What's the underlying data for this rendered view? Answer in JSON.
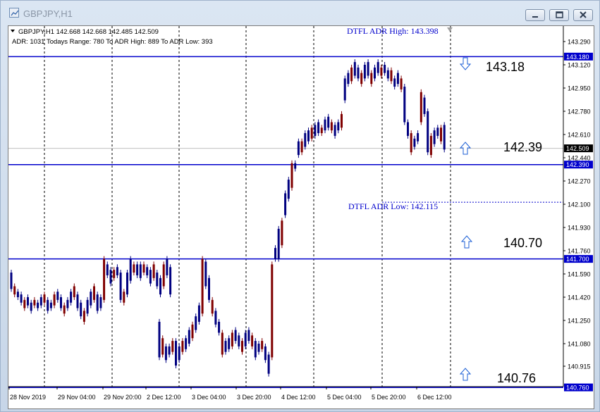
{
  "window": {
    "title": "GBPJPY,H1"
  },
  "header": {
    "symbol_line": "GBPJPY,H1  142.668 142.668 142.485 142.509",
    "adr_line": "ADR: 1031  Todays Range: 780  To ADR High: 889  To ADR Low: 393"
  },
  "annotations": {
    "adr_high": "DTFL ADR High: 143.398",
    "adr_low": "DTFL ADR Low: 142.115"
  },
  "levels": [
    {
      "price": 143.18,
      "label": "143.18",
      "price_tag": "143.180",
      "arrow": "down"
    },
    {
      "price": 142.39,
      "label": "142.39",
      "price_tag": "142.390",
      "arrow": "up"
    },
    {
      "price": 141.7,
      "label": "140.70",
      "price_tag": "141.700",
      "arrow": "up"
    },
    {
      "price": 140.76,
      "label": "140.76",
      "price_tag": "140.760",
      "arrow": "up"
    }
  ],
  "current_price": {
    "value": 142.509,
    "label": "142.509"
  },
  "colors": {
    "level_line": "#0000cc",
    "bull_candle": "#000080",
    "bear_candle": "#800000",
    "annotation_text": "#0000cc",
    "price_tag_bg": "#0000cc",
    "current_tag_bg": "#000000"
  },
  "chart_data": {
    "type": "candlestick",
    "y_ticks": [
      "143.290",
      "143.120",
      "142.950",
      "142.780",
      "142.610",
      "142.440",
      "142.270",
      "142.100",
      "141.930",
      "141.760",
      "141.590",
      "141.420",
      "141.250",
      "141.080",
      "140.915"
    ],
    "x_ticks": [
      "28 Nov 2019",
      "29 Nov 04:00",
      "29 Nov 20:00",
      "2 Dec 12:00",
      "3 Dec 04:00",
      "3 Dec 20:00",
      "4 Dec 12:00",
      "5 Dec 04:00",
      "5 Dec 20:00",
      "6 Dec 12:00"
    ],
    "ylim": [
      140.75,
      143.4
    ],
    "series": [
      {
        "segment": 1,
        "points": [
          [
            141.48,
            141.6
          ],
          [
            141.44,
            141.5
          ],
          [
            141.42,
            141.46
          ],
          [
            141.38,
            141.44
          ],
          [
            141.34,
            141.4
          ],
          [
            141.36,
            141.42
          ],
          [
            141.32,
            141.38
          ],
          [
            141.36,
            141.4
          ],
          [
            141.34,
            141.38
          ],
          [
            141.36,
            141.42
          ],
          [
            141.38,
            141.44
          ],
          [
            141.32,
            141.4
          ],
          [
            141.34,
            141.38
          ],
          [
            141.36,
            141.44
          ],
          [
            141.4,
            141.46
          ],
          [
            141.34,
            141.42
          ],
          [
            141.3,
            141.36
          ],
          [
            141.34,
            141.4
          ],
          [
            141.38,
            141.46
          ],
          [
            141.42,
            141.5
          ],
          [
            141.34,
            141.44
          ],
          [
            141.28,
            141.38
          ],
          [
            141.24,
            141.32
          ],
          [
            141.3,
            141.4
          ],
          [
            141.36,
            141.46
          ],
          [
            141.4,
            141.5
          ],
          [
            141.32,
            141.44
          ],
          [
            141.34,
            141.42
          ],
          [
            141.4,
            141.7
          ],
          [
            141.58,
            141.66
          ],
          [
            141.52,
            141.62
          ],
          [
            141.56,
            141.62
          ],
          [
            141.58,
            141.64
          ],
          [
            141.4,
            141.6
          ],
          [
            141.38,
            141.46
          ],
          [
            141.44,
            141.6
          ],
          [
            141.54,
            141.7
          ],
          [
            141.6,
            141.66
          ],
          [
            141.58,
            141.66
          ],
          [
            141.56,
            141.66
          ],
          [
            141.6,
            141.66
          ],
          [
            141.58,
            141.64
          ],
          [
            141.52,
            141.62
          ],
          [
            141.56,
            141.66
          ],
          [
            141.5,
            141.6
          ],
          [
            141.44,
            141.56
          ],
          [
            141.5,
            141.66
          ],
          [
            141.58,
            141.7
          ],
          [
            141.44,
            141.64
          ]
        ]
      },
      {
        "segment": 2,
        "points": [
          [
            140.98,
            141.24
          ],
          [
            141.0,
            141.12
          ],
          [
            140.96,
            141.06
          ],
          [
            141.0,
            141.06
          ],
          [
            141.02,
            141.1
          ],
          [
            140.92,
            141.1
          ],
          [
            140.96,
            141.06
          ],
          [
            141.02,
            141.1
          ],
          [
            141.04,
            141.12
          ],
          [
            141.08,
            141.18
          ],
          [
            141.12,
            141.22
          ],
          [
            141.18,
            141.28
          ],
          [
            141.24,
            141.36
          ],
          [
            141.3,
            141.7
          ],
          [
            141.5,
            141.68
          ],
          [
            141.4,
            141.56
          ],
          [
            141.3,
            141.4
          ],
          [
            141.22,
            141.32
          ],
          [
            141.16,
            141.24
          ],
          [
            141.0,
            141.16
          ],
          [
            141.02,
            141.1
          ],
          [
            141.04,
            141.12
          ],
          [
            141.06,
            141.16
          ],
          [
            141.1,
            141.18
          ],
          [
            141.06,
            141.14
          ],
          [
            141.02,
            141.1
          ],
          [
            141.06,
            141.16
          ],
          [
            141.1,
            141.18
          ],
          [
            141.06,
            141.14
          ],
          [
            140.98,
            141.1
          ],
          [
            141.02,
            141.08
          ],
          [
            141.04,
            141.1
          ],
          [
            140.96,
            141.06
          ],
          [
            140.86,
            141.0
          ],
          [
            140.98,
            141.66
          ],
          [
            141.7,
            141.78
          ],
          [
            141.7,
            141.92
          ],
          [
            141.8,
            141.98
          ],
          [
            142.02,
            142.18
          ],
          [
            142.14,
            142.28
          ],
          [
            142.22,
            142.4
          ],
          [
            142.36,
            142.4
          ],
          [
            142.46,
            142.56
          ],
          [
            142.48,
            142.56
          ],
          [
            142.52,
            142.62
          ],
          [
            142.56,
            142.64
          ],
          [
            142.58,
            142.66
          ],
          [
            142.6,
            142.68
          ],
          [
            142.62,
            142.7
          ],
          [
            142.62,
            142.66
          ],
          [
            142.64,
            142.72
          ],
          [
            142.66,
            142.74
          ],
          [
            142.64,
            142.7
          ],
          [
            142.6,
            142.68
          ],
          [
            142.64,
            142.7
          ],
          [
            142.66,
            142.76
          ],
          [
            142.86,
            143.02
          ],
          [
            142.98,
            143.06
          ],
          [
            143.0,
            143.1
          ],
          [
            143.04,
            143.14
          ],
          [
            143.02,
            143.1
          ],
          [
            142.98,
            143.06
          ],
          [
            143.02,
            143.12
          ],
          [
            143.04,
            143.14
          ],
          [
            142.98,
            143.06
          ],
          [
            143.02,
            143.1
          ],
          [
            143.06,
            143.14
          ],
          [
            143.04,
            143.1
          ],
          [
            143.06,
            143.12
          ],
          [
            143.02,
            143.08
          ],
          [
            143.0,
            143.08
          ],
          [
            142.96,
            143.02
          ],
          [
            142.98,
            143.06
          ],
          [
            142.94,
            143.02
          ],
          [
            142.7,
            142.96
          ],
          [
            142.6,
            142.7
          ],
          [
            142.48,
            142.62
          ],
          [
            142.52,
            142.58
          ],
          [
            142.56,
            142.62
          ],
          [
            142.7,
            142.92
          ],
          [
            142.76,
            142.88
          ],
          [
            142.48,
            142.78
          ],
          [
            142.46,
            142.6
          ],
          [
            142.54,
            142.64
          ],
          [
            142.6,
            142.66
          ],
          [
            142.56,
            142.66
          ],
          [
            142.5,
            142.68
          ]
        ]
      }
    ]
  }
}
